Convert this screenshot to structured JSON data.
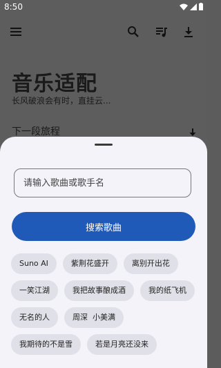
{
  "status": {
    "time": "8:50"
  },
  "toolbar": {
    "icons": [
      "menu-icon",
      "search-icon",
      "playlist-icon",
      "download-icon"
    ]
  },
  "main": {
    "title": "音乐适配",
    "subtitle": "长风破浪会有时，直挂云...",
    "section": "下一段旅程"
  },
  "sheet": {
    "search_placeholder": "请输入歌曲或歌手名",
    "search_button": "搜索歌曲",
    "chips": [
      "Suno AI",
      "紫荆花盛开",
      "离别开出花",
      "一笑江湖",
      "我把故事酿成酒",
      "我的纸飞机",
      "无名的人",
      "周深  小美满",
      "我期待的不是雪",
      "若是月亮还没来"
    ]
  }
}
